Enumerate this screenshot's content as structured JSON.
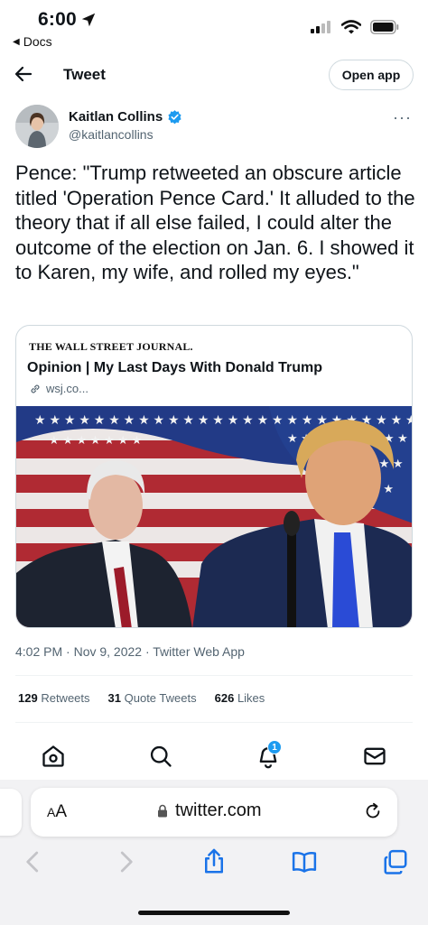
{
  "status_bar": {
    "time": "6:00",
    "back_app": "Docs"
  },
  "header": {
    "title": "Tweet",
    "open_app": "Open app"
  },
  "author": {
    "name": "Kaitlan Collins",
    "handle": "@kaitlancollins"
  },
  "tweet": {
    "text": "Pence: \"Trump retweeted an obscure article titled 'Operation Pence Card.' It alluded to the theory that if all else failed, I could alter the outcome of the election on Jan. 6. I showed it to Karen, my wife, and rolled my eyes.\"",
    "timestamp": "4:02 PM · Nov 9, 2022 · Twitter Web App"
  },
  "card": {
    "source": "THE WALL STREET JOURNAL.",
    "title": "Opinion | My Last Days With Donald Trump",
    "domain": "wsj.co..."
  },
  "stats": {
    "retweets_count": "129",
    "retweets_label": "Retweets",
    "quotes_count": "31",
    "quotes_label": "Quote Tweets",
    "likes_count": "626",
    "likes_label": "Likes"
  },
  "tabbar": {
    "notifications_badge": "1"
  },
  "safari": {
    "aa_big": "A",
    "aa_small": "A",
    "url": "twitter.com"
  },
  "colors": {
    "accent": "#1d9bf0",
    "text": "#0f1419",
    "muted": "#536471",
    "border": "#cfd9de",
    "safari_blue": "#1a73e8"
  }
}
